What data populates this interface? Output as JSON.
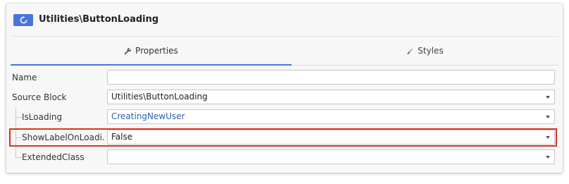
{
  "header": {
    "title": "Utilities\\ButtonLoading",
    "icon": "refresh-icon",
    "icon_color": "#4a74dc"
  },
  "tabs": [
    {
      "label": "Properties",
      "icon": "wrench-icon",
      "active": true
    },
    {
      "label": "Styles",
      "icon": "brush-icon",
      "active": false
    }
  ],
  "properties": {
    "name": {
      "label": "Name",
      "value": ""
    },
    "source_block": {
      "label": "Source Block",
      "value": "Utilities\\ButtonLoading"
    },
    "is_loading": {
      "label": "IsLoading",
      "value": "CreatingNewUser"
    },
    "show_label": {
      "label": "ShowLabelOnLoadi…",
      "value": "False"
    },
    "extended_class": {
      "label": "ExtendedClass",
      "value": ""
    }
  },
  "colors": {
    "accent": "#4a74dc",
    "highlight": "#d1371f",
    "link_value": "#2f5fb3"
  }
}
